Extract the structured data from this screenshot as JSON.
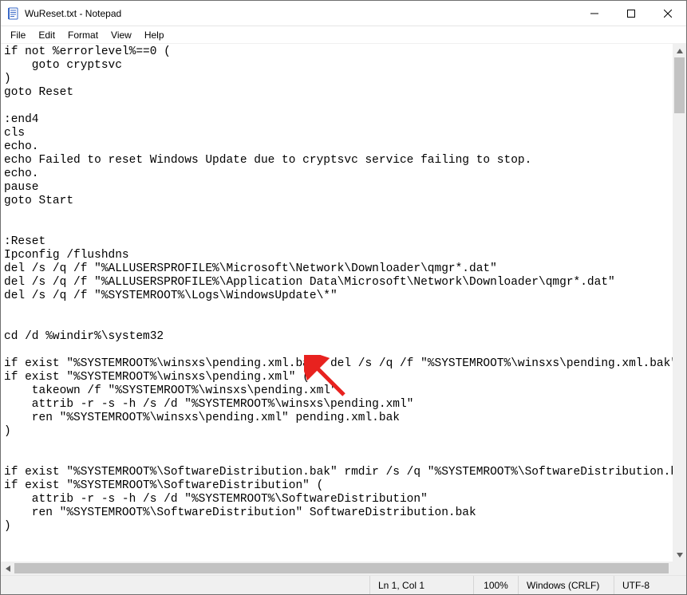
{
  "titlebar": {
    "title": "WuReset.txt - Notepad"
  },
  "menu": {
    "file": "File",
    "edit": "Edit",
    "format": "Format",
    "view": "View",
    "help": "Help"
  },
  "content": "if not %errorlevel%==0 (\n    goto cryptsvc\n)\ngoto Reset\n\n:end4\ncls\necho.\necho Failed to reset Windows Update due to cryptsvc service failing to stop.\necho.\npause\ngoto Start\n\n\n:Reset\nIpconfig /flushdns\ndel /s /q /f \"%ALLUSERSPROFILE%\\Microsoft\\Network\\Downloader\\qmgr*.dat\"\ndel /s /q /f \"%ALLUSERSPROFILE%\\Application Data\\Microsoft\\Network\\Downloader\\qmgr*.dat\"\ndel /s /q /f \"%SYSTEMROOT%\\Logs\\WindowsUpdate\\*\"\n\n\ncd /d %windir%\\system32\n\nif exist \"%SYSTEMROOT%\\winsxs\\pending.xml.bak\" del /s /q /f \"%SYSTEMROOT%\\winsxs\\pending.xml.bak\"\nif exist \"%SYSTEMROOT%\\winsxs\\pending.xml\" (\n    takeown /f \"%SYSTEMROOT%\\winsxs\\pending.xml\"\n    attrib -r -s -h /s /d \"%SYSTEMROOT%\\winsxs\\pending.xml\"\n    ren \"%SYSTEMROOT%\\winsxs\\pending.xml\" pending.xml.bak\n)\n\n\nif exist \"%SYSTEMROOT%\\SoftwareDistribution.bak\" rmdir /s /q \"%SYSTEMROOT%\\SoftwareDistribution.bak\"\nif exist \"%SYSTEMROOT%\\SoftwareDistribution\" (\n    attrib -r -s -h /s /d \"%SYSTEMROOT%\\SoftwareDistribution\"\n    ren \"%SYSTEMROOT%\\SoftwareDistribution\" SoftwareDistribution.bak\n)\n\n",
  "status": {
    "position": "Ln 1, Col 1",
    "zoom": "100%",
    "eol": "Windows (CRLF)",
    "encoding": "UTF-8"
  }
}
